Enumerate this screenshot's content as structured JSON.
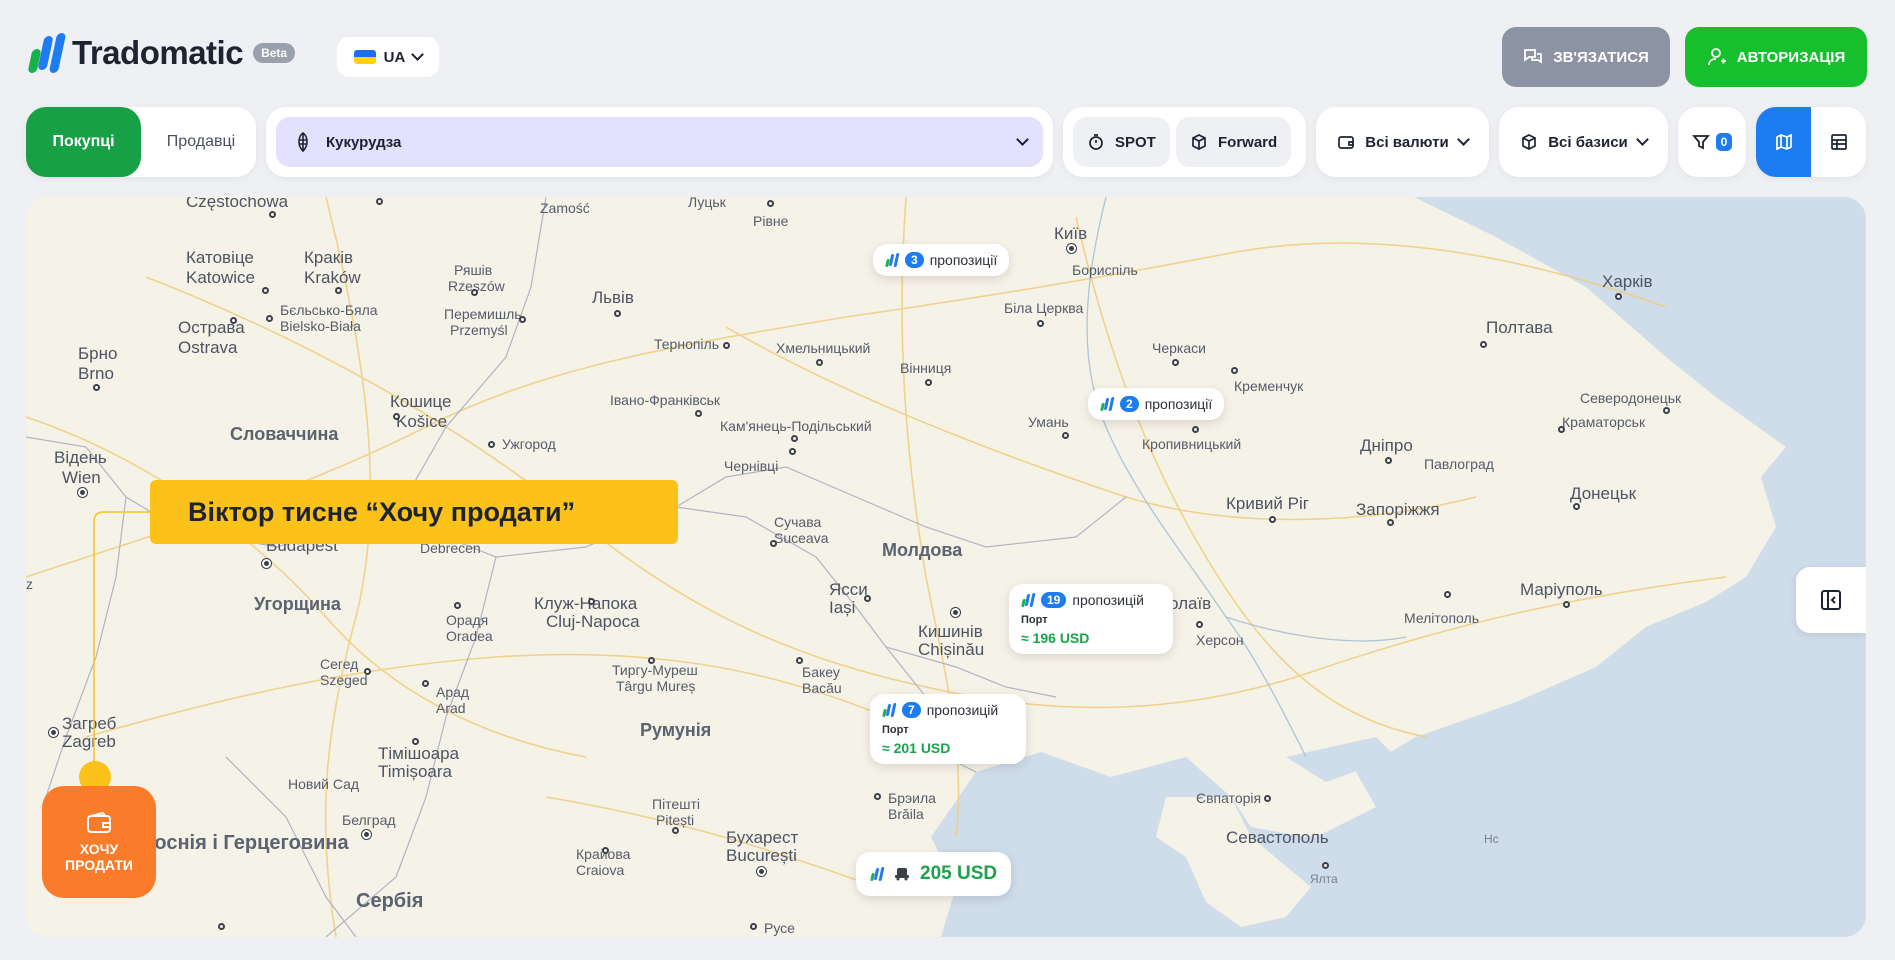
{
  "header": {
    "logo_text": "Tradomatic",
    "beta_badge": "Beta",
    "language": "UA",
    "contact_label": "ЗВ'ЯЗАТИСЯ",
    "auth_label": "АВТОРИЗАЦІЯ"
  },
  "toolbar": {
    "buyers_tab": "Покупці",
    "sellers_tab": "Продавці",
    "crop_selected": "Кукурудза",
    "spot_label": "SPOT",
    "forward_label": "Forward",
    "currency_label": "Всі валюти",
    "basis_label": "Всі базиси",
    "filter_count": "0"
  },
  "map": {
    "cities": {
      "czestochowa": "Częstochowa",
      "zamosc": "Zamość",
      "lutsk": "Луцьк",
      "rivne": "Рівне",
      "kyiv": "Київ",
      "boryspil": "Бориспіль",
      "katovice": "Катовіце",
      "katowice": "Katowice",
      "krakiv": "Краків",
      "krakow": "Kraków",
      "rzeszow_ua": "Ряшів",
      "rzeszow": "Rzeszów",
      "lviv": "Львів",
      "kharkiv": "Харків",
      "bielsko_ua": "Бєльсько-Бяла",
      "bielsko": "Bielsko-Biała",
      "przemysl_ua": "Перемишль",
      "przemysl": "Przemyśl",
      "bila_tserkva": "Біла Церква",
      "poltava": "Полтава",
      "ostrava_ua": "Острава",
      "ostrava": "Ostrava",
      "ternopil": "Тернопіль",
      "khmelnytskyi": "Хмельницький",
      "cherkasy": "Черкаси",
      "brno_ua": "Брно",
      "brno": "Brno",
      "vinnytsia": "Вінниця",
      "kremenchuk": "Кременчук",
      "sievierodonetsk": "Северодонецьк",
      "kosice_ua": "Кошице",
      "kosice": "Košice",
      "ivano_frankivsk": "Івано-Франківськ",
      "uman": "Умань",
      "kramatorsk": "Краматорськ",
      "slovakia": "Словаччина",
      "kamianets": "Кам'янець-Подільський",
      "uzhhorod": "Ужгород",
      "kropyvnytskyi": "Кропивницький",
      "dnipro": "Дніпро",
      "vienna_ua": "Відень",
      "vienna": "Wien",
      "chernivtsi": "Чернівці",
      "pavlohrad": "Павлоград",
      "kryvyi_rih": "Кривий Ріг",
      "donetsk": "Донецьк",
      "suceava_ua": "Сучава",
      "suceava": "Suceava",
      "zaporizhzhia": "Запоріжжя",
      "budapest": "Budapest",
      "debrecen": "Debrecen",
      "moldova": "Молдова",
      "mariupol": "Маріуполь",
      "iasi_ua": "Ясси",
      "iasi": "Iași",
      "hungary": "Угорщина",
      "cluj_ua": "Клуж-Напока",
      "cluj": "Cluj-Napoca",
      "mykolaiv_part": "олаїв",
      "melitopol": "Мелітополь",
      "chisinau_ua": "Кишинів",
      "chisinau": "Chișinău",
      "oradea_ua": "Орадя",
      "oradea": "Oradea",
      "kherson": "Херсон",
      "szeged_ua": "Сегед",
      "szeged": "Szeged",
      "tirgu_ua": "Тиргу-Муреш",
      "tirgu": "Târgu Mureș",
      "bacau_ua": "Бакеу",
      "bacau": "Bacău",
      "arad_ua": "Арад",
      "arad": "Arad",
      "zagreb_ua": "Загреб",
      "zagreb": "Zagreb",
      "romania": "Румунія",
      "timisoara_ua": "Тімішоара",
      "timisoara": "Timișoara",
      "novi_sad": "Новий Сад",
      "evpatoria": "Євпаторія",
      "braila_ua": "Брэила",
      "braila": "Brăila",
      "pitesti_ua": "Пітешті",
      "pitesti": "Pitești",
      "beograd": "Белград",
      "bosnia": "Боснія і Герцеговина",
      "bucharest_ua": "Бухарест",
      "bucharest": "București",
      "sevastopol": "Севастополь",
      "krayova_ua": "Крайова",
      "krayova": "Craiova",
      "yalta": "Ялта",
      "serbia": "Сербія",
      "ruse": "Русе",
      "edge_z": "z",
      "edge_nc": "Нс"
    },
    "offers": [
      {
        "count": "3",
        "label": "пропозиції"
      },
      {
        "count": "2",
        "label": "пропозиції"
      },
      {
        "count": "19",
        "label": "пропозицій",
        "port": "Порт",
        "price": "≈ 196 USD"
      },
      {
        "count": "7",
        "label": "пропозицій",
        "port": "Порт",
        "price": "≈ 201 USD"
      }
    ],
    "truck_price": "205 USD",
    "callout": "Віктор тисне “Хочу продати”",
    "sell_button_line1": "ХОЧУ",
    "sell_button_line2": "ПРОДАТИ"
  },
  "colors": {
    "brand_green": "#16c02c",
    "brand_blue": "#1e7cf2",
    "callout_yellow": "#fcc21a",
    "sell_orange": "#fa7c2a",
    "sea": "#cfdcea"
  }
}
